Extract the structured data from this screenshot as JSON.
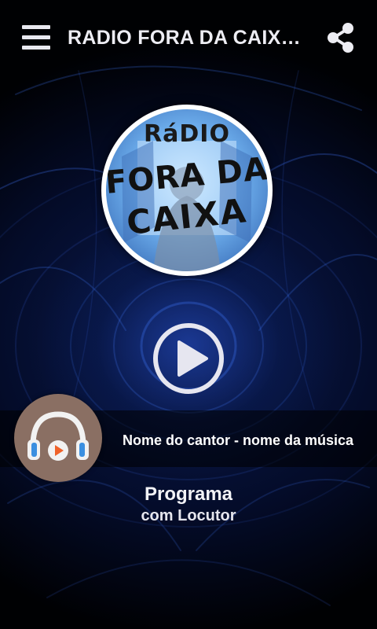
{
  "header": {
    "title": "RADIO FORA DA CAIXA...",
    "menu_icon": "hamburger-menu-icon",
    "share_icon": "share-icon"
  },
  "station_logo": {
    "line1": "RáDIO",
    "line2": "FORA DA",
    "line3": "CAIXA"
  },
  "player": {
    "play_icon": "play-icon",
    "now_playing": "Nome do cantor - nome da música",
    "cover_icon": "headphones-play-icon"
  },
  "program": {
    "title": "Programa",
    "host": "com Locutor"
  },
  "colors": {
    "background": "#02061a",
    "accent_blue": "#2a6fe0",
    "cover_bg": "#8a6f63",
    "headphone_blue": "#3b8fe0",
    "play_orange": "#f0622a"
  }
}
